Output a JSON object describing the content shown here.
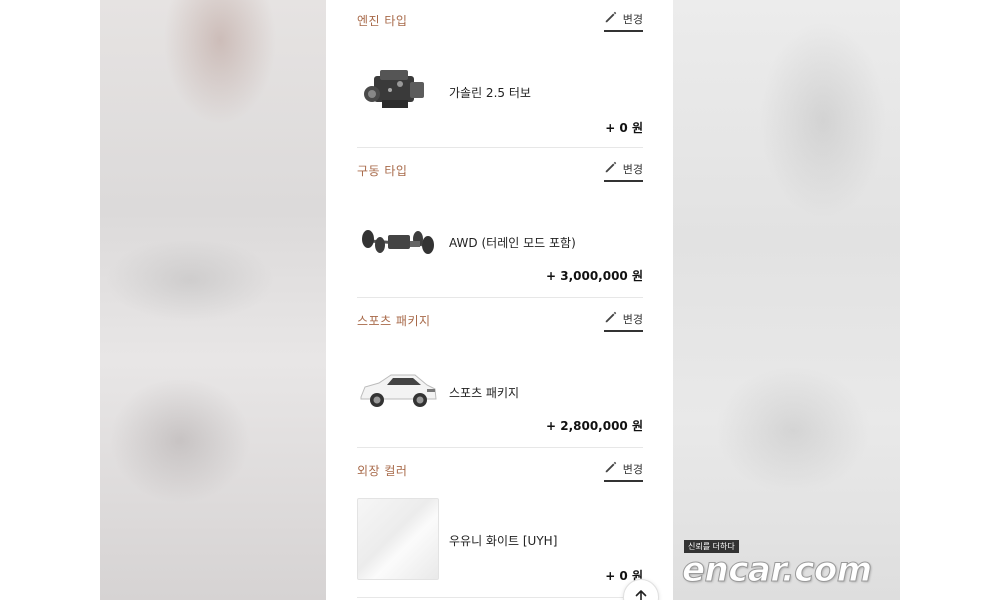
{
  "sections": [
    {
      "title": "엔진 타입",
      "change_label": "변경",
      "option_name": "가솔린 2.5 터보",
      "price": "+ 0 원",
      "thumb_icon": "engine-image"
    },
    {
      "title": "구동 타입",
      "change_label": "변경",
      "option_name": "AWD (터레인 모드 포함)",
      "price": "+ 3,000,000 원",
      "thumb_icon": "drivetrain-image"
    },
    {
      "title": "스포츠 패키지",
      "change_label": "변경",
      "option_name": "스포츠 패키지",
      "price": "+ 2,800,000 원",
      "thumb_icon": "suv-car-image"
    },
    {
      "title": "외장 컬러",
      "change_label": "변경",
      "option_name": "우유니 화이트 [UYH]",
      "price": "+ 0 원",
      "thumb_icon": "white-color-swatch"
    }
  ],
  "watermark": {
    "tagline": "신뢰를 더하다",
    "logo": "encar.com"
  },
  "colors": {
    "section_title": "#a86a4a",
    "text": "#222222",
    "divider": "#e7e7e7"
  },
  "icons": {
    "change": "pencil-icon",
    "scroll_top": "arrow-up-icon"
  }
}
